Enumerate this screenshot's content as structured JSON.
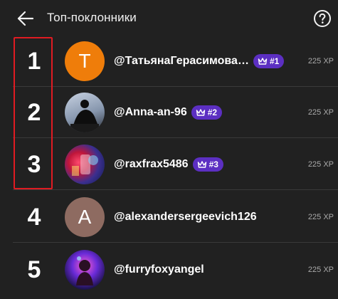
{
  "header": {
    "title": "Топ-поклонники",
    "back_icon": "arrow-left-icon",
    "help_icon": "help-circle-icon"
  },
  "entries": [
    {
      "rank": "1",
      "handle": "@ТатьянаГерасимова-я...",
      "badge": "#1",
      "xp": "225 XP",
      "avatar": {
        "type": "letter",
        "letter": "T",
        "color": "#ef7d0a"
      }
    },
    {
      "rank": "2",
      "handle": "@Anna-an-96",
      "badge": "#2",
      "xp": "225 XP",
      "avatar": {
        "type": "image",
        "desc": "silhouette"
      }
    },
    {
      "rank": "3",
      "handle": "@raxfrax5486",
      "badge": "#3",
      "xp": "225 XP",
      "avatar": {
        "type": "image",
        "desc": "colorful"
      }
    },
    {
      "rank": "4",
      "handle": "@alexandersergeevich126",
      "xp": "225 XP",
      "avatar": {
        "type": "letter",
        "letter": "A",
        "color": "#8e6b61"
      }
    },
    {
      "rank": "5",
      "handle": "@furryfoxyangel",
      "xp": "225 XP",
      "avatar": {
        "type": "image",
        "desc": "neon"
      }
    }
  ],
  "colors": {
    "background": "#212121",
    "badge": "#5c2fc2",
    "highlight": "#e01b22",
    "divider": "#3a3a3a"
  }
}
